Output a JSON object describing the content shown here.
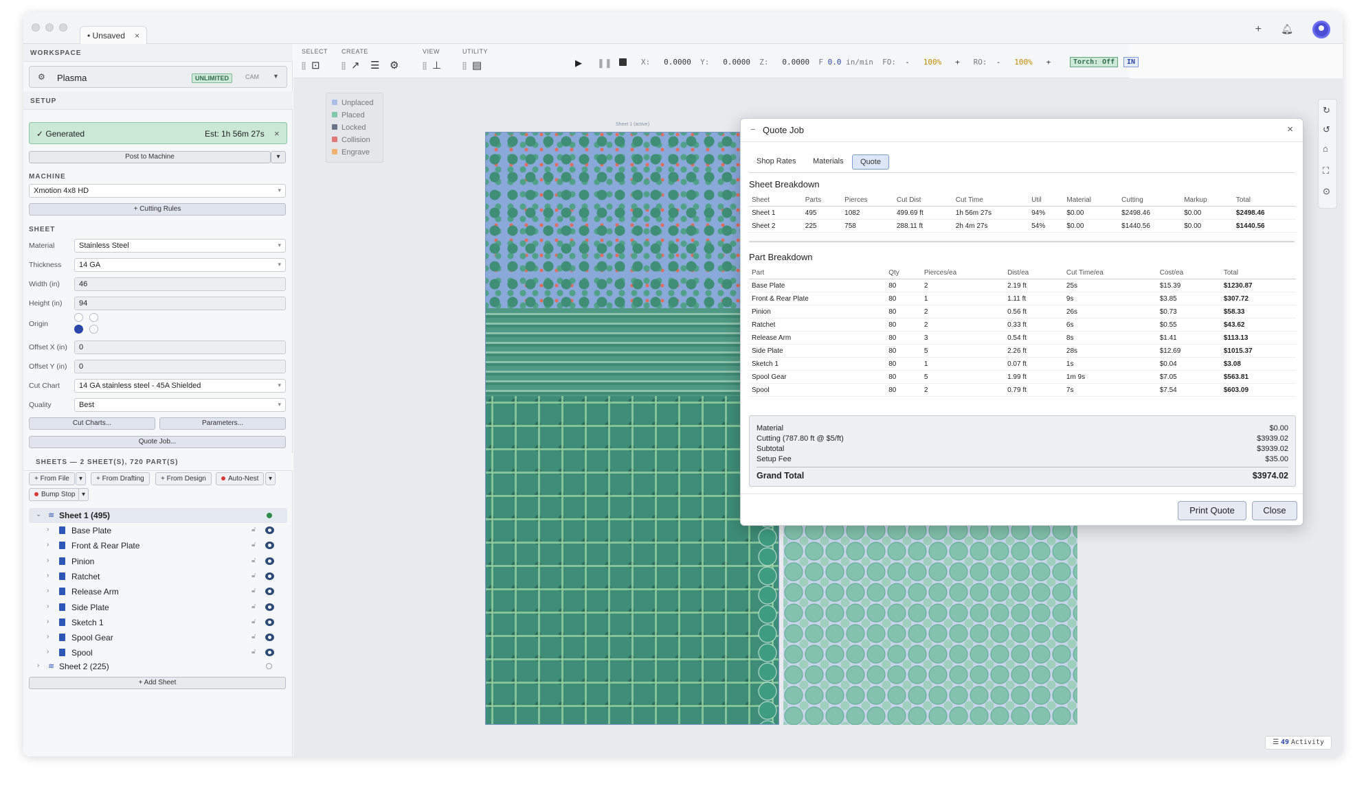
{
  "window": {
    "tab_label": "• Unsaved",
    "tab_close": "×"
  },
  "workspace": {
    "heading": "WORKSPACE",
    "name": "Plasma",
    "badge": "UNLIMITED",
    "mode": "CAM"
  },
  "setup": {
    "heading": "SETUP",
    "status": "✓ Generated",
    "estimate": "Est: 1h 56m 27s",
    "status_close": "×",
    "post_label": "Post to Machine"
  },
  "machine": {
    "heading": "MACHINE",
    "value": "Xmotion 4x8 HD",
    "cutting_rules": "+ Cutting Rules"
  },
  "sheet": {
    "heading": "SHEET",
    "material_label": "Material",
    "material": "Stainless Steel",
    "thickness_label": "Thickness",
    "thickness": "14 GA",
    "width_label": "Width (in)",
    "width": "46",
    "height_label": "Height (in)",
    "height": "94",
    "origin_label": "Origin",
    "offset_x_label": "Offset X (in)",
    "offset_x": "0",
    "offset_y_label": "Offset Y (in)",
    "offset_y": "0",
    "cut_chart_label": "Cut Chart",
    "cut_chart": "14 GA stainless steel - 45A Shielded",
    "quality_label": "Quality",
    "quality": "Best",
    "cut_charts_btn": "Cut Charts...",
    "parameters_btn": "Parameters...",
    "quote_btn": "Quote Job..."
  },
  "sheets": {
    "heading": "SHEETS — 2 SHEET(S), 720 PART(S)",
    "from_file": "+ From File",
    "from_drafting": "+ From Drafting",
    "from_design": "+ From Design",
    "auto_nest": "Auto-Nest",
    "bump_stop": "Bump Stop",
    "sheet1": "Sheet 1 (495)",
    "sheet2": "Sheet 2 (225)",
    "add_sheet": "+ Add Sheet",
    "parts": [
      "Base Plate",
      "Front & Rear Plate",
      "Pinion",
      "Ratchet",
      "Release Arm",
      "Side Plate",
      "Sketch 1",
      "Spool Gear",
      "Spool"
    ]
  },
  "toolbar": {
    "select": "SELECT",
    "create": "CREATE",
    "view": "VIEW",
    "utility": "UTILITY",
    "x_label": "X:",
    "x": "0.0000",
    "y_label": "Y:",
    "y": "0.0000",
    "z_label": "Z:",
    "z": "0.0000",
    "f_label": "F",
    "f": "0.0",
    "f_unit": "in/min",
    "fo_label": "FO:",
    "fo_minus": "-",
    "fo": "100%",
    "fo_plus": "+",
    "ro_label": "RO:",
    "ro_minus": "-",
    "ro": "100%",
    "ro_plus": "+",
    "torch": "Torch: Off",
    "units": "IN"
  },
  "legend": {
    "unplaced": "Unplaced",
    "placed": "Placed",
    "locked": "Locked",
    "collision": "Collision",
    "engrave": "Engrave",
    "colors": {
      "unplaced": "#a9bfe8",
      "placed": "#7fc8a9",
      "locked": "#6b7388",
      "collision": "#e07878",
      "engrave": "#f0b070"
    }
  },
  "canvas": {
    "sheet_label": "Sheet 1 (active)"
  },
  "activity": {
    "count": "49",
    "label": "Activity"
  },
  "quote": {
    "title": "Quote Job",
    "close": "×",
    "tabs": [
      "Shop Rates",
      "Materials",
      "Quote"
    ],
    "sheet_breakdown": "Sheet Breakdown",
    "sheet_cols": [
      "Sheet",
      "Parts",
      "Pierces",
      "Cut Dist",
      "Cut Time",
      "Util",
      "Material",
      "Cutting",
      "Markup",
      "Total"
    ],
    "sheet_rows": [
      [
        "Sheet 1",
        "495",
        "1082",
        "499.69 ft",
        "1h 56m 27s",
        "94%",
        "$0.00",
        "$2498.46",
        "$0.00",
        "$2498.46"
      ],
      [
        "Sheet 2",
        "225",
        "758",
        "288.11 ft",
        "2h 4m 27s",
        "54%",
        "$0.00",
        "$1440.56",
        "$0.00",
        "$1440.56"
      ]
    ],
    "part_breakdown": "Part Breakdown",
    "part_cols": [
      "Part",
      "Qty",
      "Pierces/ea",
      "Dist/ea",
      "Cut Time/ea",
      "Cost/ea",
      "Total"
    ],
    "part_rows": [
      [
        "Base Plate",
        "80",
        "2",
        "2.19 ft",
        "25s",
        "$15.39",
        "$1230.87"
      ],
      [
        "Front & Rear Plate",
        "80",
        "1",
        "1.11 ft",
        "9s",
        "$3.85",
        "$307.72"
      ],
      [
        "Pinion",
        "80",
        "2",
        "0.56 ft",
        "26s",
        "$0.73",
        "$58.33"
      ],
      [
        "Ratchet",
        "80",
        "2",
        "0.33 ft",
        "6s",
        "$0.55",
        "$43.62"
      ],
      [
        "Release Arm",
        "80",
        "3",
        "0.54 ft",
        "8s",
        "$1.41",
        "$113.13"
      ],
      [
        "Side Plate",
        "80",
        "5",
        "2.26 ft",
        "28s",
        "$12.69",
        "$1015.37"
      ],
      [
        "Sketch 1",
        "80",
        "1",
        "0.07 ft",
        "1s",
        "$0.04",
        "$3.08"
      ],
      [
        "Spool Gear",
        "80",
        "5",
        "1.99 ft",
        "1m 9s",
        "$7.05",
        "$563.81"
      ],
      [
        "Spool",
        "80",
        "2",
        "0.79 ft",
        "7s",
        "$7.54",
        "$603.09"
      ]
    ],
    "summary": {
      "material_label": "Material",
      "material": "$0.00",
      "cutting_label": "Cutting (787.80 ft @ $5/ft)",
      "cutting": "$3939.02",
      "subtotal_label": "Subtotal",
      "subtotal": "$3939.02",
      "setup_label": "Setup Fee",
      "setup": "$35.00",
      "grand_label": "Grand Total",
      "grand": "$3974.02"
    },
    "print": "Print Quote",
    "close_btn": "Close"
  }
}
